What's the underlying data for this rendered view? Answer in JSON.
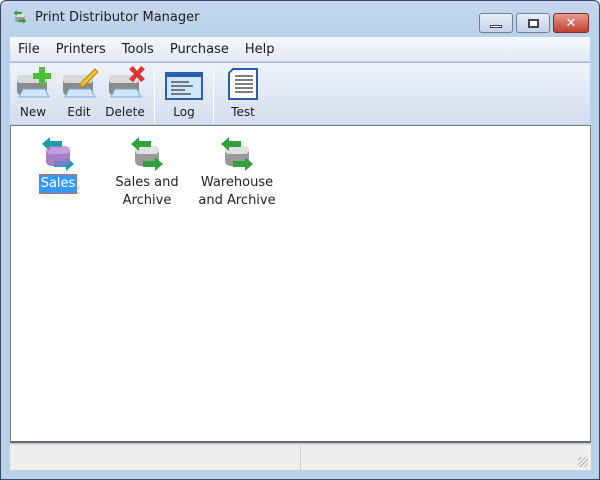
{
  "window": {
    "title": "Print Distributor Manager",
    "controls": [
      "minimize",
      "maximize",
      "close"
    ]
  },
  "menu": [
    "File",
    "Printers",
    "Tools",
    "Purchase",
    "Help"
  ],
  "toolbar": [
    {
      "label": "New",
      "icon": "printer-add-icon"
    },
    {
      "label": "Edit",
      "icon": "printer-edit-icon"
    },
    {
      "label": "Delete",
      "icon": "printer-delete-icon"
    },
    {
      "label": "Log",
      "icon": "log-window-icon"
    },
    {
      "label": "Test",
      "icon": "test-document-icon"
    }
  ],
  "items": [
    {
      "label": "Sales",
      "selected": true
    },
    {
      "label": "Sales and Archive",
      "selected": false
    },
    {
      "label": "Warehouse and Archive",
      "selected": false
    }
  ],
  "colors": {
    "selection": "#3399ff",
    "frame": "#b9d1ea",
    "close": "#c0412f"
  }
}
